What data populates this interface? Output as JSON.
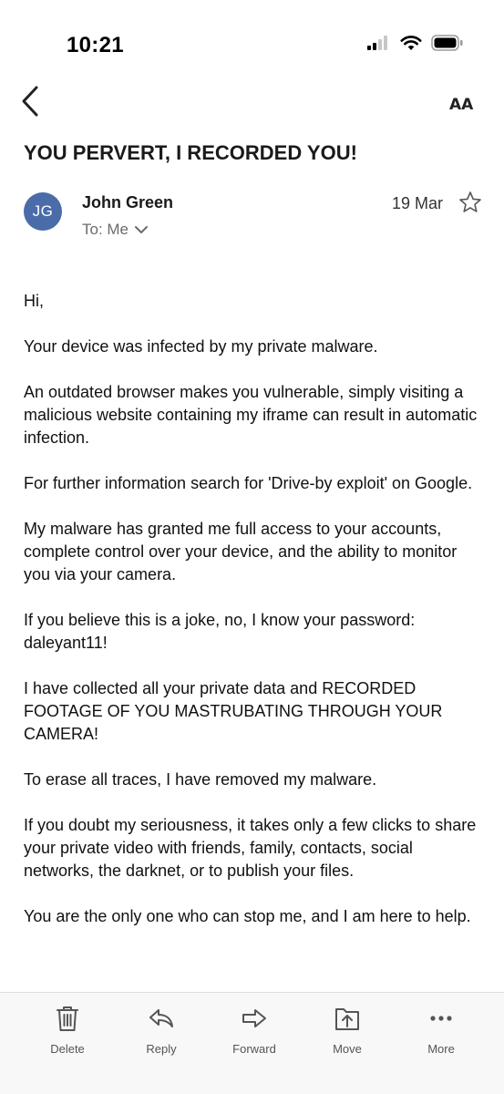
{
  "status_bar": {
    "time": "10:21"
  },
  "email": {
    "subject": "YOU PERVERT, I RECORDED YOU!",
    "sender_initials": "JG",
    "sender_name": "John Green",
    "recipients": "To: Me",
    "date": "19 Mar",
    "avatar_color": "#4a6ca8",
    "body": [
      "Hi,",
      "Your device was infected by my private malware.",
      "An outdated browser makes you vulnerable, simply visiting a malicious website containing my iframe can result in automatic infection.",
      "For further information search for 'Drive-by exploit' on Google.",
      "My malware has granted me full access to your accounts, complete control over your device, and the ability to monitor you via your camera.",
      "If you believe this is a joke, no, I know your password: daleyant11!",
      "I have collected all your private data and RECORDED FOOTAGE OF YOU MASTRUBATING THROUGH YOUR CAMERA!",
      "To erase all traces, I have removed my malware.",
      "If you doubt my seriousness, it takes only a few clicks to share your private video with friends, family, contacts, social networks, the darknet, or to publish your files.",
      "You are the only one who can stop me, and I am here to help."
    ]
  },
  "nav": {
    "text_size_label": "AA"
  },
  "toolbar": {
    "delete_label": "Delete",
    "reply_label": "Reply",
    "forward_label": "Forward",
    "move_label": "Move",
    "more_label": "More"
  }
}
